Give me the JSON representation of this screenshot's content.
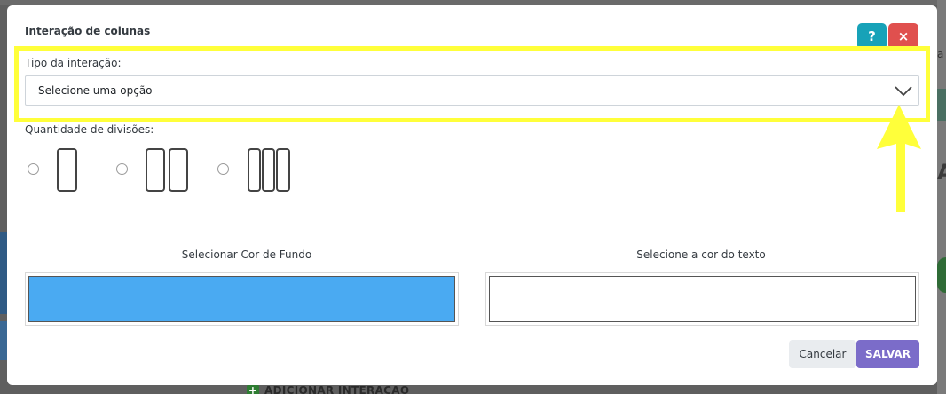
{
  "background": {
    "add_interaction_label": "ADICIONAR INTERAÇÃO",
    "right_edge_text": "a",
    "right_edge_letter": "A"
  },
  "modal": {
    "title": "Interação de colunas",
    "help_label": "?",
    "close_label": "×",
    "interaction_type": {
      "label": "Tipo da interação:",
      "selected_value": "Selecione uma opção"
    },
    "divisions": {
      "label": "Quantidade de divisões:",
      "options": [
        {
          "columns": 1,
          "selected": false
        },
        {
          "columns": 2,
          "selected": false
        },
        {
          "columns": 3,
          "selected": false
        }
      ]
    },
    "background_color": {
      "label": "Selecionar Cor de Fundo",
      "value": "#4aaaf2"
    },
    "text_color": {
      "label": "Selecione a cor do texto",
      "value": "#ffffff"
    },
    "cancel_label": "Cancelar",
    "save_label": "SALVAR"
  },
  "colors": {
    "highlight": "#ffff3a",
    "help_button": "#17a2b8",
    "close_button": "#e0504e",
    "save_button": "#7b6cc9"
  }
}
